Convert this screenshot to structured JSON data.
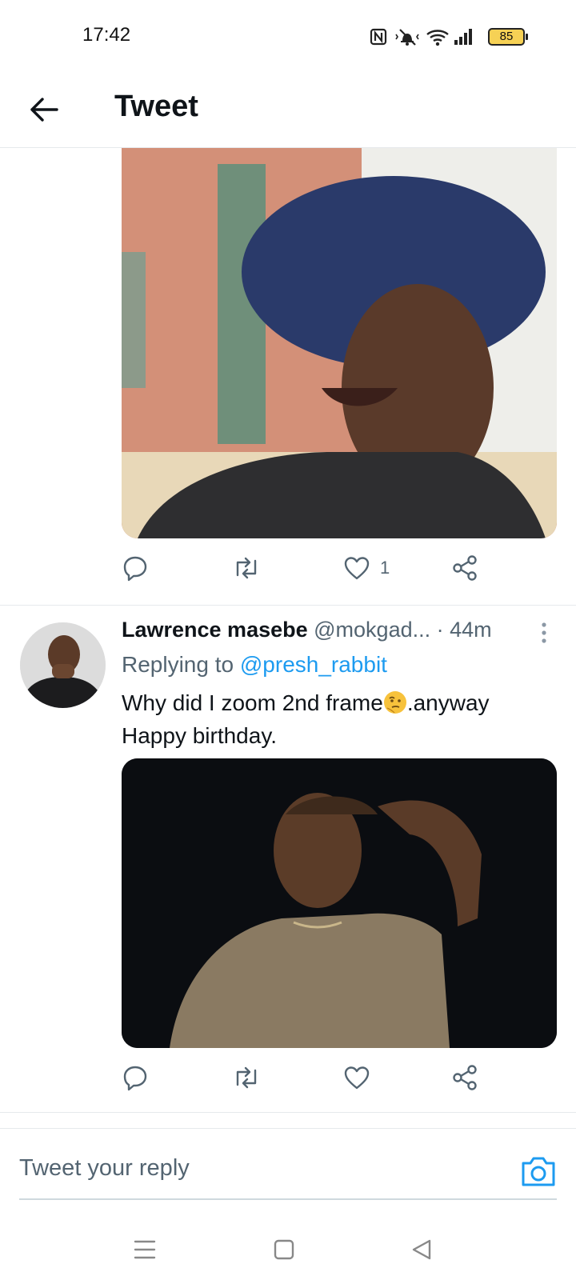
{
  "status_bar": {
    "time": "17:42",
    "battery": "85",
    "icons": [
      "nfc-icon",
      "vibrate-off-icon",
      "wifi-icon",
      "cell-signal-icon",
      "battery-icon"
    ]
  },
  "header": {
    "title": "Tweet"
  },
  "tweet1": {
    "like_count": "1"
  },
  "tweet2": {
    "author_name": "Lawrence masebe",
    "author_handle": "@mokgad...",
    "separator": " · ",
    "time": "44m",
    "replying_prefix": "Replying to ",
    "replying_to": "@presh_rabbit",
    "text_part1": "Why did I zoom 2nd frame",
    "text_part2": ".anyway",
    "text_line2": "Happy birthday."
  },
  "reply": {
    "placeholder": "Tweet your reply"
  },
  "colors": {
    "accent": "#1d9bf0",
    "text_secondary": "#536471",
    "divider": "#e6e9ec"
  }
}
